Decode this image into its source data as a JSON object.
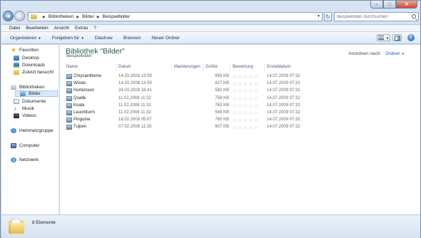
{
  "window": {
    "controls": {
      "minimize": "–",
      "maximize": "□",
      "close": "✕"
    }
  },
  "address_bar": {
    "crumbs": [
      "Bibliotheken",
      "Bilder",
      "Beispielbilder"
    ],
    "refresh_glyph": "↻"
  },
  "search": {
    "placeholder": "Beispielbilder durchsuchen"
  },
  "menu": [
    "Datei",
    "Bearbeiten",
    "Ansicht",
    "Extras",
    "?"
  ],
  "command_bar": {
    "organize": "Organisieren",
    "share": "Freigeben für",
    "slideshow": "Diashow",
    "burn": "Brennen",
    "new_folder": "Neuer Ordner",
    "help": "?"
  },
  "nav": {
    "favorites": "Favoriten",
    "desktop": "Desktop",
    "downloads": "Downloads",
    "recent": "Zuletzt besucht",
    "libraries": "Bibliotheken",
    "pictures": "Bilder",
    "documents": "Dokumente",
    "music": "Musik",
    "videos": "Videos",
    "homegroup": "Heimnetzgruppe",
    "computer": "Computer",
    "network": "Netzwerk"
  },
  "library": {
    "title": "Bibliothek \"Bilder\"",
    "subtitle": "Beispielbilder",
    "arrange_label": "Anordnen nach:",
    "arrange_value": "Ordner"
  },
  "columns": {
    "name": "Name",
    "date": "Datum",
    "tags": "Markierungen",
    "size": "Größe",
    "rating": "Bewertung",
    "created": "Erstelldatum"
  },
  "files": [
    {
      "name": "Chrysantheme",
      "date": "14.03.2008 13:59",
      "size": "859 KB",
      "rating": 0,
      "created": "14.07.2009 07:32"
    },
    {
      "name": "Wüste",
      "date": "14.03.2008 13:59",
      "size": "827 KB",
      "rating": 0,
      "created": "14.07.2009 07:32"
    },
    {
      "name": "Hortensien",
      "date": "24.03.2008 16:41",
      "size": "582 KB",
      "rating": 0,
      "created": "14.07.2009 07:32"
    },
    {
      "name": "Qualle",
      "date": "11.02.2008 11:32",
      "size": "758 KB",
      "rating": 0,
      "created": "14.07.2009 07:32"
    },
    {
      "name": "Koala",
      "date": "11.02.2008 11:32",
      "size": "763 KB",
      "rating": 0,
      "created": "14.07.2009 07:32"
    },
    {
      "name": "Leuchtturm",
      "date": "11.02.2008 11:32",
      "size": "549 KB",
      "rating": 0,
      "created": "14.07.2009 07:32"
    },
    {
      "name": "Pinguine",
      "date": "18.02.2008 05:07",
      "size": "760 KB",
      "rating": 0,
      "created": "14.07.2009 07:32"
    },
    {
      "name": "Tulpen",
      "date": "07.02.2008 11:33",
      "size": "607 KB",
      "rating": 0,
      "created": "14.07.2009 07:32"
    }
  ],
  "details": {
    "count": "8 Elemente"
  }
}
